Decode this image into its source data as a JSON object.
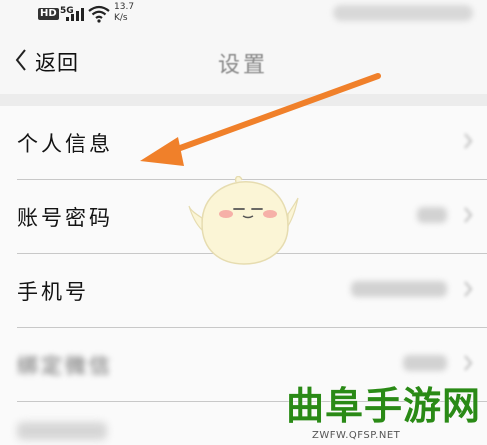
{
  "status_bar": {
    "hd": "HD",
    "network": "5G",
    "speed_value": "13.7",
    "speed_unit": "K/s"
  },
  "header": {
    "back_label": "返回",
    "title": "设置"
  },
  "settings": {
    "items": [
      {
        "label": "个人信息"
      },
      {
        "label": "账号密码"
      },
      {
        "label": "手机号"
      },
      {
        "label": "绑定微信"
      }
    ]
  },
  "watermark": {
    "text": "曲阜手游网",
    "url": "ZWFW.QFSP.NET"
  },
  "colors": {
    "arrow": "#f0802a",
    "watermark": "#2a8a16",
    "background": "#fafafa"
  },
  "icons": {
    "back": "chevron-left-icon",
    "row_chevron": "chevron-right-icon",
    "wifi": "wifi-icon",
    "signal": "signal-bars-icon"
  }
}
